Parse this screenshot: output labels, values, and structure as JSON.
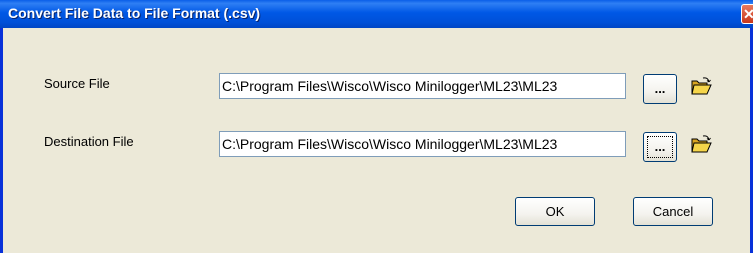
{
  "window": {
    "title": "Convert File Data to File Format (.csv)",
    "close_icon_glyph": "✕"
  },
  "source": {
    "label": "Source File",
    "value": "C:\\Program Files\\Wisco\\Wisco Minilogger\\ML23\\ML23",
    "browse_label": "...",
    "open_icon": "open-folder-icon"
  },
  "destination": {
    "label": "Destination File",
    "value": "C:\\Program Files\\Wisco\\Wisco Minilogger\\ML23\\ML23",
    "browse_label": "...",
    "open_icon": "open-folder-icon"
  },
  "buttons": {
    "ok_label": "OK",
    "cancel_label": "Cancel"
  },
  "colors": {
    "titlebar": "#0058e6",
    "dialog_bg": "#ece9d8",
    "close_button": "#c9371b",
    "folder_icon": "#f0c040"
  }
}
